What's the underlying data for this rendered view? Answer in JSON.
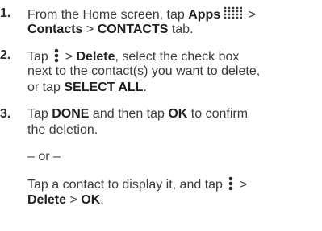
{
  "steps": [
    {
      "number": "1.",
      "line1_pre": "From the Home screen, tap ",
      "apps_label": "Apps",
      "line1_post": " >",
      "contacts": "Contacts",
      "sep": " > ",
      "contacts_tab": "CONTACTS",
      "tab_suffix": " tab."
    },
    {
      "number": "2.",
      "tap": "Tap ",
      "gt": " > ",
      "delete_label": "Delete",
      "line1_post": ", select the check box",
      "line2": "next to the contact(s) you want to delete,",
      "line3_pre": "or tap ",
      "select_all": "SELECT ALL",
      "line3_post": "."
    },
    {
      "number": "3.",
      "tap": "Tap ",
      "done_label": "DONE",
      "mid": " and then tap ",
      "ok_label": "OK",
      "line1_post": " to confirm",
      "line2": "the deletion.",
      "or_text": "– or –",
      "alt_line1": "Tap a contact to display it, and tap ",
      "alt_gt": " >",
      "alt_delete": "Delete",
      "alt_sep": " > ",
      "alt_ok": "OK",
      "alt_end": "."
    }
  ],
  "icons": {
    "apps": "apps-grid-icon",
    "menu": "more-vertical-icon"
  }
}
